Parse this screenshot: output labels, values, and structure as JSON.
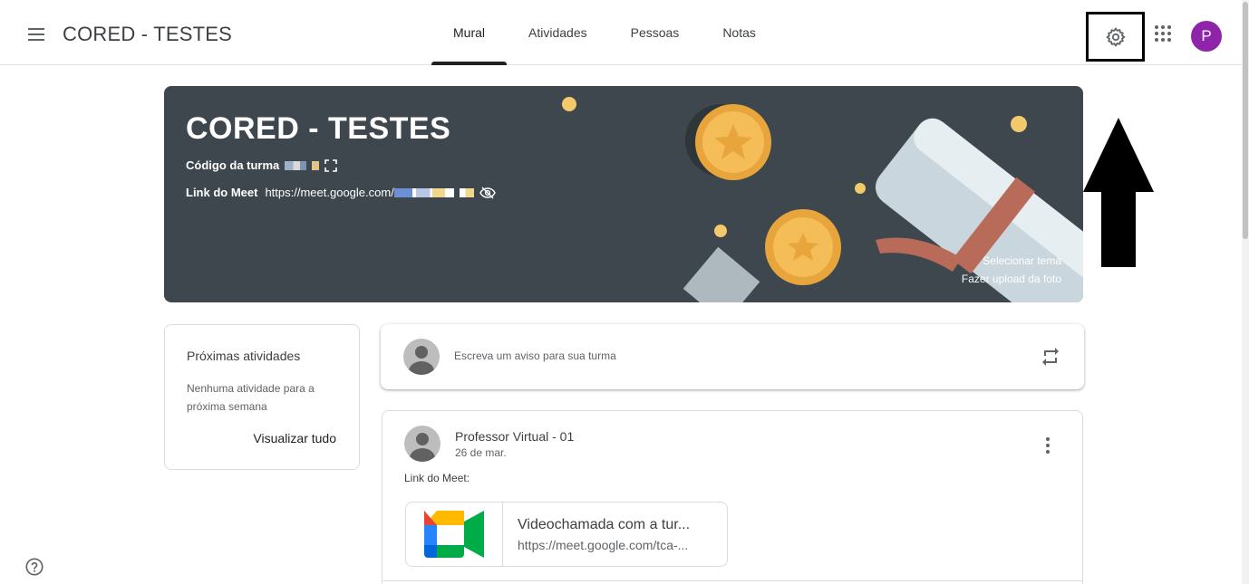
{
  "header": {
    "class_name": "CORED - TESTES",
    "tabs": [
      {
        "label": "Mural",
        "active": true
      },
      {
        "label": "Atividades",
        "active": false
      },
      {
        "label": "Pessoas",
        "active": false
      },
      {
        "label": "Notas",
        "active": false
      }
    ],
    "avatar_initial": "P",
    "avatar_color": "#8e24aa"
  },
  "banner": {
    "title": "CORED - TESTES",
    "code_label": "Código da turma",
    "meet_label": "Link do Meet",
    "meet_url": "https://meet.google.com/",
    "select_theme": "Selecionar tema",
    "upload_photo": "Fazer upload da foto",
    "background_color": "#3e474d"
  },
  "upcoming": {
    "title": "Próximas atividades",
    "empty_text": "Nenhuma atividade para a próxima semana",
    "view_all": "Visualizar tudo"
  },
  "announce": {
    "placeholder": "Escreva um aviso para sua turma"
  },
  "post": {
    "author": "Professor Virtual - 01",
    "date": "26 de mar.",
    "body": "Link do Meet:",
    "attachment": {
      "title": "Videochamada com a tur...",
      "url": "https://meet.google.com/tca-..."
    }
  }
}
